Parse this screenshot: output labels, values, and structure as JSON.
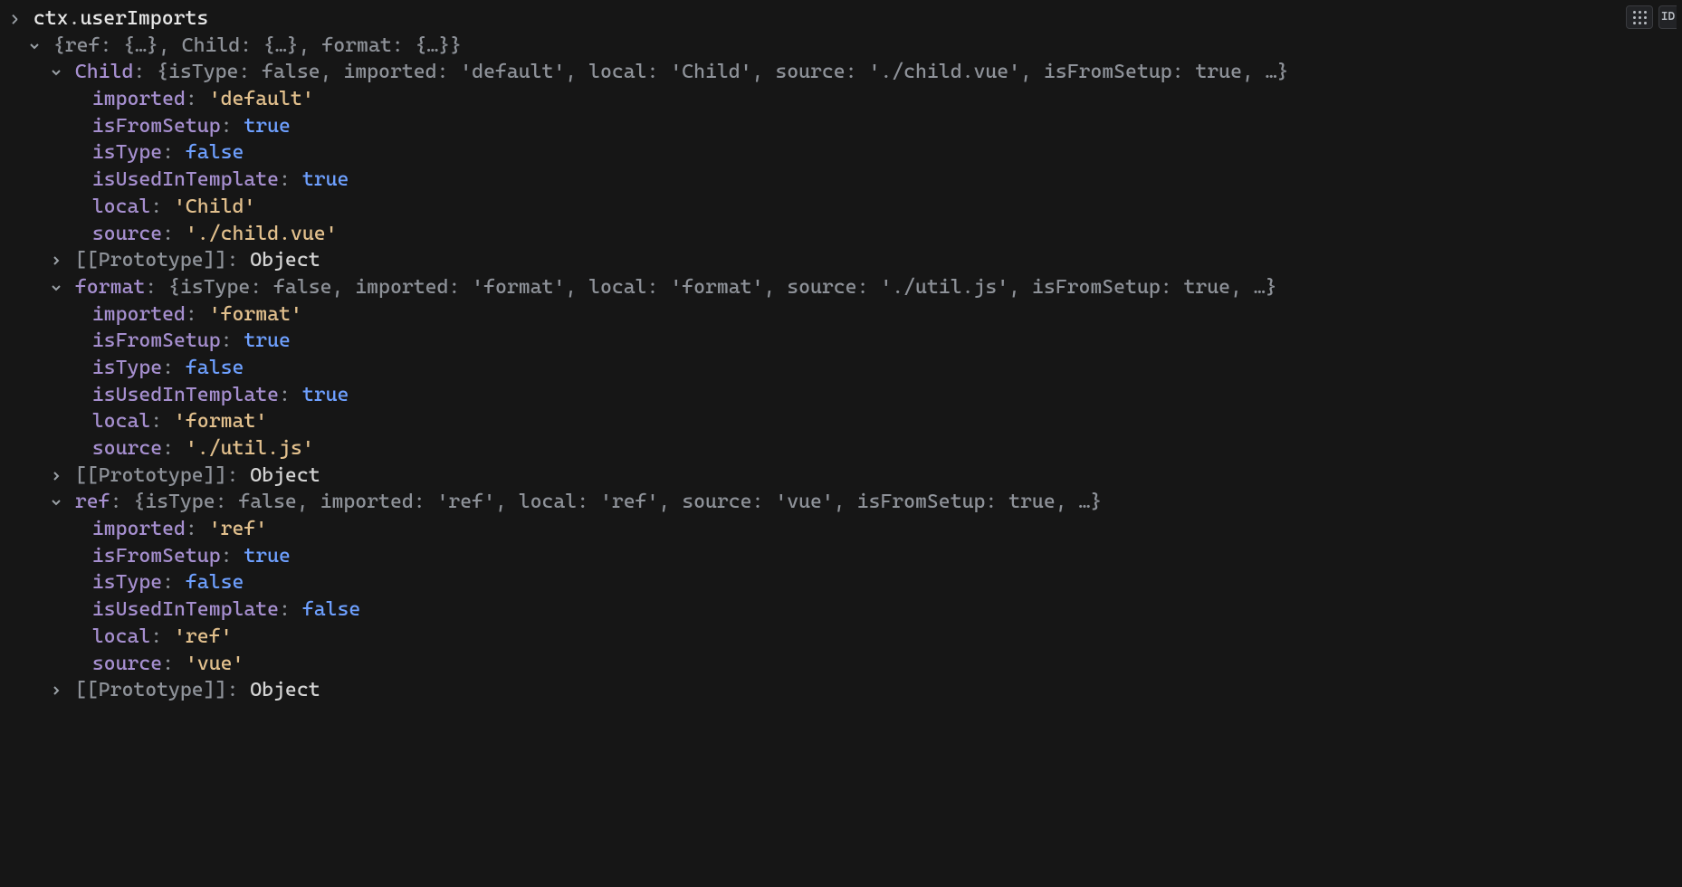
{
  "command": {
    "obj": "ctx",
    "prop": "userImports"
  },
  "root_summary": "{ref: {…}, Child: {…}, format: {…}}",
  "toolbar": {
    "drag_title": "Drag",
    "id_label": "ID"
  },
  "proto": {
    "label": "[[Prototype]]",
    "value": "Object"
  },
  "entries": [
    {
      "key": "Child",
      "summary": "{isType: false, imported: 'default', local: 'Child', source: './child.vue', isFromSetup: true, …}",
      "props": [
        {
          "k": "imported",
          "type": "str",
          "v": "'default'"
        },
        {
          "k": "isFromSetup",
          "type": "bool",
          "v": "true"
        },
        {
          "k": "isType",
          "type": "bool",
          "v": "false"
        },
        {
          "k": "isUsedInTemplate",
          "type": "bool",
          "v": "true"
        },
        {
          "k": "local",
          "type": "str",
          "v": "'Child'"
        },
        {
          "k": "source",
          "type": "str",
          "v": "'./child.vue'"
        }
      ]
    },
    {
      "key": "format",
      "summary": "{isType: false, imported: 'format', local: 'format', source: './util.js', isFromSetup: true, …}",
      "props": [
        {
          "k": "imported",
          "type": "str",
          "v": "'format'"
        },
        {
          "k": "isFromSetup",
          "type": "bool",
          "v": "true"
        },
        {
          "k": "isType",
          "type": "bool",
          "v": "false"
        },
        {
          "k": "isUsedInTemplate",
          "type": "bool",
          "v": "true"
        },
        {
          "k": "local",
          "type": "str",
          "v": "'format'"
        },
        {
          "k": "source",
          "type": "str",
          "v": "'./util.js'"
        }
      ]
    },
    {
      "key": "ref",
      "summary": "{isType: false, imported: 'ref', local: 'ref', source: 'vue', isFromSetup: true, …}",
      "props": [
        {
          "k": "imported",
          "type": "str",
          "v": "'ref'"
        },
        {
          "k": "isFromSetup",
          "type": "bool",
          "v": "true"
        },
        {
          "k": "isType",
          "type": "bool",
          "v": "false"
        },
        {
          "k": "isUsedInTemplate",
          "type": "bool",
          "v": "false"
        },
        {
          "k": "local",
          "type": "str",
          "v": "'ref'"
        },
        {
          "k": "source",
          "type": "str",
          "v": "'vue'"
        }
      ]
    }
  ]
}
